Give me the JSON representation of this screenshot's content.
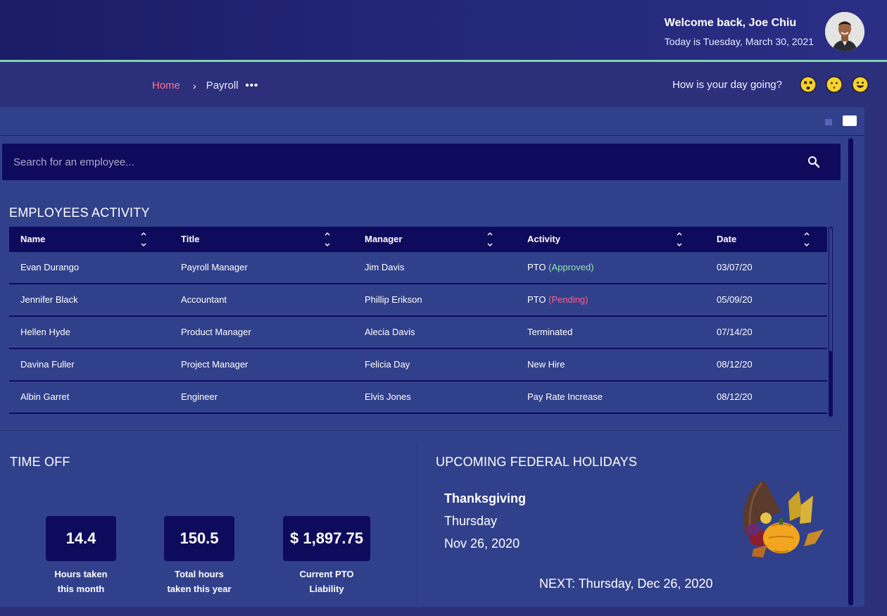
{
  "header": {
    "welcome": "Welcome back, Joe Chiu",
    "date_line": "Today is Tuesday, March 30, 2021",
    "avatar_icon": "user-avatar-photo"
  },
  "breadcrumb": {
    "home": "Home",
    "separator": "›",
    "current": "Payroll",
    "more": "•••"
  },
  "mood": {
    "label": "How is your day going?",
    "faces": [
      "dizzy-face-icon",
      "neutral-face-icon",
      "smiling-face-icon"
    ]
  },
  "search": {
    "placeholder": "Search for an employee...",
    "icon": "search-icon"
  },
  "activity": {
    "title": "EMPLOYEES ACTIVITY",
    "columns": [
      "Name",
      "Title",
      "Manager",
      "Activity",
      "Date"
    ],
    "rows": [
      {
        "name": "Evan Durango",
        "title": "Payroll Manager",
        "manager": "Jim Davis",
        "activity": "PTO",
        "status": "(Approved)",
        "date": "03/07/20"
      },
      {
        "name": "Jennifer Black",
        "title": "Accountant",
        "manager": "Phillip Erikson",
        "activity": "PTO",
        "status": "(Pending)",
        "date": "05/09/20"
      },
      {
        "name": "Hellen Hyde",
        "title": "Product Manager",
        "manager": "Alecia Davis",
        "activity": "Terminated",
        "status": "",
        "date": "07/14/20"
      },
      {
        "name": "Davina Fuller",
        "title": "Project Manager",
        "manager": "Felicia Day",
        "activity": "New Hire",
        "status": "",
        "date": "08/12/20"
      },
      {
        "name": "Albin Garret",
        "title": "Engineer",
        "manager": "Elvis Jones",
        "activity": "Pay Rate Increase",
        "status": "",
        "date": "08/12/20"
      }
    ]
  },
  "time_off": {
    "title": "TIME OFF",
    "stats": [
      {
        "value": "14.4",
        "label1": "Hours taken",
        "label2": "this month"
      },
      {
        "value": "150.5",
        "label1": "Total hours",
        "label2": "taken this year"
      },
      {
        "value": "$ 1,897.75",
        "label1": "Current PTO",
        "label2": "Liability"
      }
    ]
  },
  "holidays": {
    "title": "UPCOMING FEDERAL HOLIDAYS",
    "name": "Thanksgiving",
    "weekday": "Thursday",
    "date": "Nov 26, 2020",
    "next": "NEXT: Thursday, Dec 26, 2020",
    "image_icon": "cornucopia-icon"
  },
  "colors": {
    "accent_pink": "#ff6f91",
    "approved_green": "#8ee6a5",
    "pending_red": "#ff5f87",
    "header_border": "#7fd3b0",
    "dark_navy": "#0f0b5c",
    "panel": "#31408a"
  }
}
